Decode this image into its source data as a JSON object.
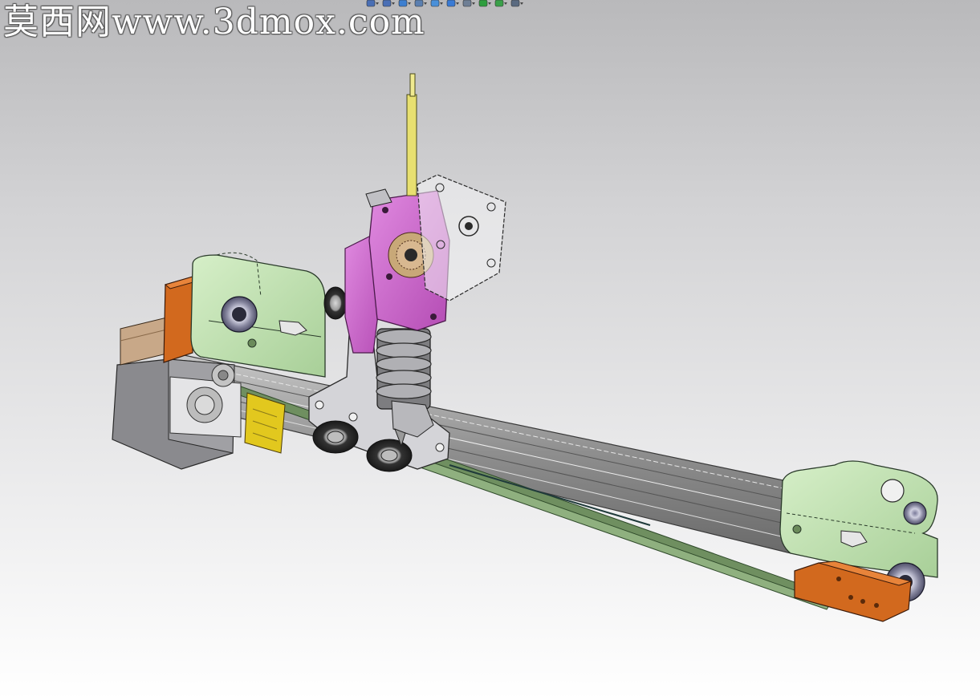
{
  "watermark": {
    "text": "莫西网www.3dmox.com"
  },
  "heads_up_toolbar": {
    "tools": [
      {
        "icon": "zoom-to-fit-icon",
        "color": "#4a6fb5"
      },
      {
        "icon": "zoom-to-area-icon",
        "color": "#4a6fb5"
      },
      {
        "icon": "previous-view-icon",
        "color": "#3d7fd0"
      },
      {
        "icon": "section-view-icon",
        "color": "#5b7fb0"
      },
      {
        "icon": "view-orientation-icon",
        "color": "#4a90d9"
      },
      {
        "icon": "display-style-icon",
        "color": "#3a7bd5"
      },
      {
        "icon": "hide-show-items-icon",
        "color": "#6f7f95"
      },
      {
        "icon": "edit-appearance-icon",
        "color": "#2f9e3f"
      },
      {
        "icon": "apply-scene-icon",
        "color": "#3aa04a"
      },
      {
        "icon": "view-settings-icon",
        "color": "#5a6a80"
      }
    ]
  },
  "model_colors": {
    "background_top": "#b9b9bb",
    "background_bottom": "#ffffff",
    "bracket_green": "#bfe0b0",
    "block_orange": "#d2691e",
    "extruder_magenta": "#cc5fcc",
    "motor_gray": "#8a8a8e",
    "rail_gray": "#9a9a9a",
    "plate_gray": "#d4d4d8",
    "belt_green": "#5a7a50",
    "heatsink_gray": "#7d7d80",
    "filament_yellow": "#e8e070",
    "wheel_dark": "#3a3a3a"
  }
}
